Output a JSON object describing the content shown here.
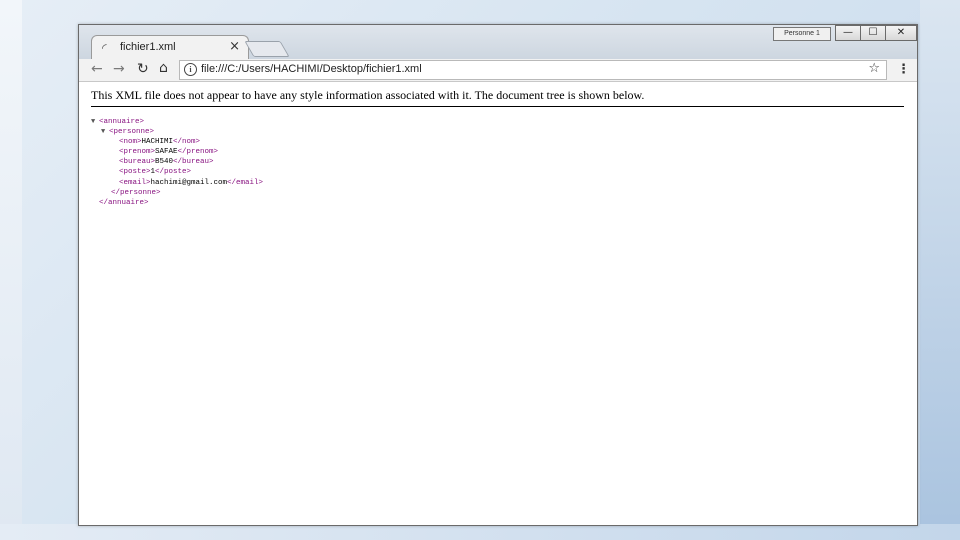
{
  "browser": {
    "tab_title": "fichier1.xml",
    "tab_close": "×",
    "user_label": "Personne 1",
    "url": "file:///C:/Users/HACHIMI/Desktop/fichier1.xml"
  },
  "icons": {
    "back": "←",
    "forward": "→",
    "reload": "↻",
    "home": "⌂",
    "info": "i",
    "star": "☆",
    "menu": "⋮",
    "minimize": "—",
    "maximize": "☐",
    "close": "✕",
    "favicon": "◜"
  },
  "page": {
    "notice": "This XML file does not appear to have any style information associated with it. The document tree is shown below."
  },
  "xml": {
    "root_open": "<annuaire>",
    "personne_open": "<personne>",
    "nom": {
      "open": "<nom>",
      "value": "HACHIMI",
      "close": "</nom>"
    },
    "prenom": {
      "open": "<prenom>",
      "value": "SAFAE",
      "close": "</prenom>"
    },
    "bureau": {
      "open": "<bureau>",
      "value": "B540",
      "close": "</bureau>"
    },
    "poste": {
      "open": "<poste>",
      "value": "1",
      "close": "</poste>"
    },
    "email": {
      "open": "<email>",
      "value": "hachimi@gmail.com",
      "close": "</email>"
    },
    "personne_close": "</personne>",
    "root_close": "</annuaire>"
  }
}
